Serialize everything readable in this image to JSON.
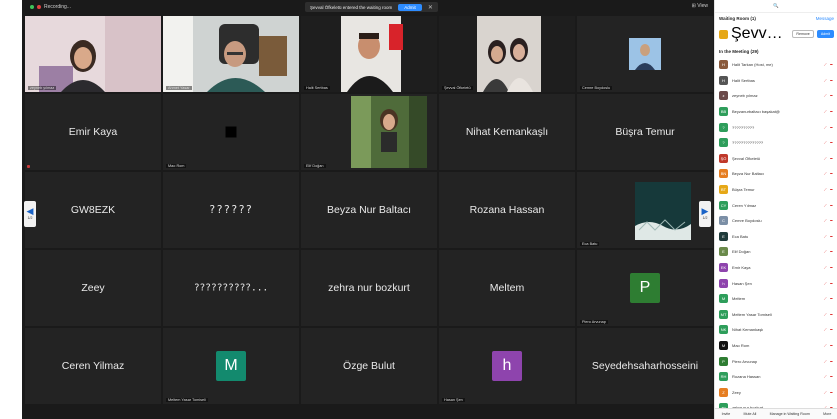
{
  "topbar": {
    "recording_label": "Recording...",
    "view_label": "View"
  },
  "notice": {
    "text": "Şevval Öfkeletü entered the waiting room",
    "admit": "Admit"
  },
  "tiles": [
    {
      "label": "zeyneb yılmaz"
    },
    {
      "label": "Ahmet Yasar"
    },
    {
      "label": "Halit Sertbas"
    },
    {
      "label": "Şevval Öfkeletü"
    },
    {
      "label": "Cemre Boydoslu"
    },
    {
      "name": "Emir Kaya"
    },
    {
      "label": "Mao Rom"
    },
    {
      "label": "Elif Doğan"
    },
    {
      "name": "Nihat Kemankaşlı"
    },
    {
      "name": "Büşra Temur"
    },
    {
      "name": "GW8EZK"
    },
    {
      "name": "??????"
    },
    {
      "name": "Beyza Nur Baltacı"
    },
    {
      "name": "Rozana Hassan"
    },
    {
      "label": "Eca Batu"
    },
    {
      "name": "Zeey"
    },
    {
      "name": "??????????..."
    },
    {
      "name": "zehra nur bozkurt"
    },
    {
      "name": "Meltem"
    },
    {
      "letter": "P",
      "color": "#2e7d32",
      "label": "Piero Arvunap"
    },
    {
      "name": "Ceren Yilmaz"
    },
    {
      "letter": "M",
      "color": "#138a6e",
      "label": "Meltem Yasar Tomiseli"
    },
    {
      "name": "Özge Bulut"
    },
    {
      "letter": "h",
      "color": "#8e44ad",
      "label": "Hasan Şen"
    },
    {
      "name": "Seyedehsaharhosseini"
    }
  ],
  "nav": {
    "left_page": "1/2",
    "right_page": "1/2"
  },
  "panel": {
    "waiting_title": "Waiting Room (1)",
    "message_all": "Message",
    "waiting_name": "Şevval Öfkeletü",
    "remove": "Remove",
    "admit": "Admit",
    "in_meeting_title": "In the Meeting (29)",
    "participants": [
      {
        "name": "Halit Tarkan (Host, me)",
        "initials": "H",
        "color": "#8a5a3c"
      },
      {
        "name": "Halit Sertbas",
        "initials": "H",
        "color": "#555555"
      },
      {
        "name": "zeyneb yılmaz",
        "initials": "z",
        "color": "#6b4a4a"
      },
      {
        "name": "Beyzanurbaltacı başakat@",
        "initials": "BB",
        "color": "#2e9e5b"
      },
      {
        "name": "??????????",
        "initials": "?",
        "color": "#2e9e5b"
      },
      {
        "name": "??????????????",
        "initials": "?",
        "color": "#2e9e5b"
      },
      {
        "name": "Şevval Öfkeletü",
        "initials": "ŞÖ",
        "color": "#c0392b"
      },
      {
        "name": "Beyza Nur Baltacı",
        "initials": "BN",
        "color": "#e67e22"
      },
      {
        "name": "Büşra Temur",
        "initials": "BT",
        "color": "#e6a817"
      },
      {
        "name": "Ceren Yılmaz",
        "initials": "CY",
        "color": "#2e9e5b"
      },
      {
        "name": "Cemre Boydoslu",
        "initials": "C",
        "color": "#7b8fa6"
      },
      {
        "name": "Eca Batu",
        "initials": "E",
        "color": "#1f3b3a"
      },
      {
        "name": "Elif Doğan",
        "initials": "E",
        "color": "#6a8a4a"
      },
      {
        "name": "Emir Kaya",
        "initials": "EK",
        "color": "#8e44ad"
      },
      {
        "name": "Hasan Şen",
        "initials": "h",
        "color": "#8e44ad"
      },
      {
        "name": "Meltem",
        "initials": "M",
        "color": "#2e9e5b"
      },
      {
        "name": "Meltem Yasar Tomiseli",
        "initials": "MT",
        "color": "#2e9e5b"
      },
      {
        "name": "Nihat Kemankaşlı",
        "initials": "NK",
        "color": "#2e9e5b"
      },
      {
        "name": "Mao Rom",
        "initials": "M",
        "color": "#111111"
      },
      {
        "name": "Piero Arvunap",
        "initials": "P",
        "color": "#2e7d32"
      },
      {
        "name": "Rozana Hassan",
        "initials": "RH",
        "color": "#2e9e5b"
      },
      {
        "name": "Zeey",
        "initials": "Z",
        "color": "#e67e22"
      },
      {
        "name": "zehra nur bozkurt",
        "initials": "zn",
        "color": "#2e9e5b"
      }
    ],
    "footer": [
      "Invite",
      "Mute All",
      "Manage in Waiting Room",
      "More"
    ]
  }
}
